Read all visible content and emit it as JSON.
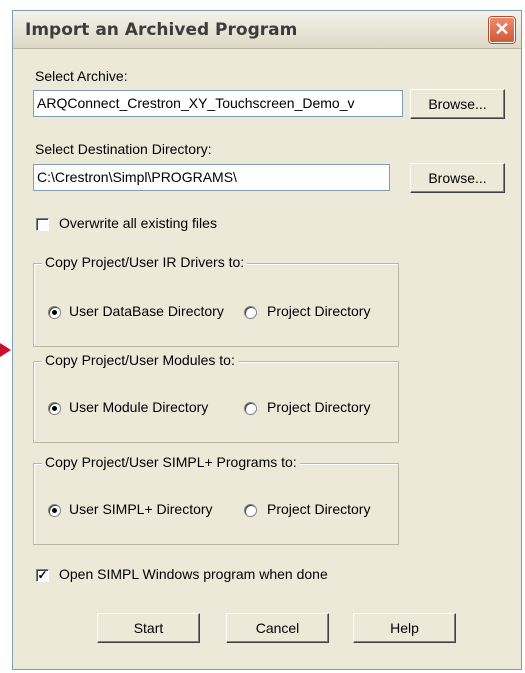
{
  "window": {
    "title": "Import an Archived Program",
    "close_label": "✕"
  },
  "archive": {
    "label": "Select Archive:",
    "value": "ARQConnect_Crestron_XY_Touchscreen_Demo_v",
    "browse_label": "Browse..."
  },
  "destination": {
    "label": "Select Destination Directory:",
    "value": "C:\\Crestron\\Simpl\\PROGRAMS\\",
    "browse_label": "Browse..."
  },
  "overwrite": {
    "label": "Overwrite all existing files",
    "checked": false
  },
  "ir_drivers": {
    "legend": "Copy Project/User IR Drivers to:",
    "option1": "User DataBase Directory",
    "option2": "Project Directory",
    "selected": "option1"
  },
  "modules": {
    "legend": "Copy Project/User Modules to:",
    "option1": "User Module Directory",
    "option2": "Project Directory",
    "selected": "option1"
  },
  "simpl_plus": {
    "legend": "Copy Project/User SIMPL+ Programs to:",
    "option1": "User SIMPL+ Directory",
    "option2": "Project Directory",
    "selected": "option1"
  },
  "open_when_done": {
    "label": "Open SIMPL Windows program when done",
    "checked": true,
    "check_glyph": "✓"
  },
  "buttons": {
    "start": "Start",
    "cancel": "Cancel",
    "help": "Help"
  },
  "colors": {
    "indicator_arrow": "#c8102e"
  }
}
